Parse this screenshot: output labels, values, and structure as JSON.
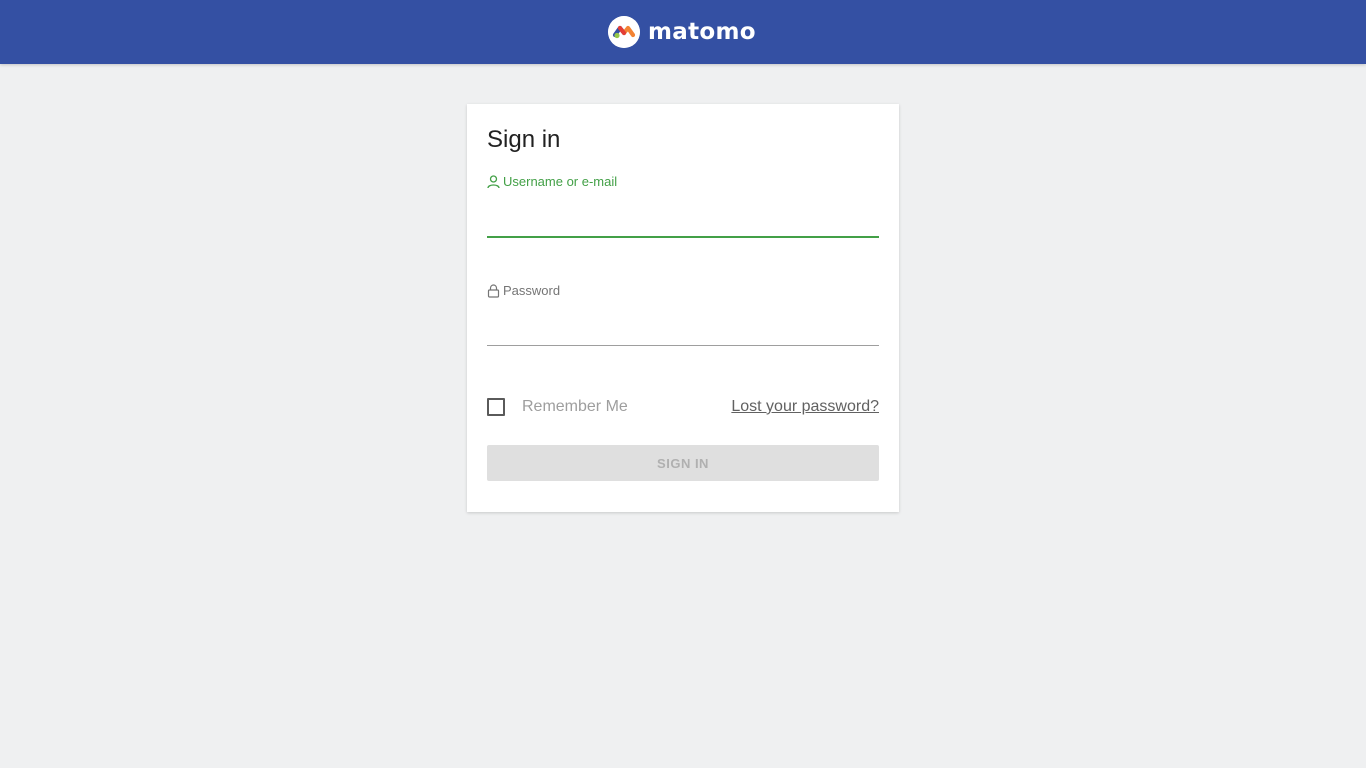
{
  "brand": {
    "name": "matomo",
    "header_color": "#3450a3"
  },
  "login": {
    "title": "Sign in",
    "username": {
      "label": "Username or e-mail",
      "icon": "user-icon",
      "value": "",
      "placeholder": "",
      "accent": "#43a047"
    },
    "password": {
      "label": "Password",
      "icon": "lock-icon",
      "value": "",
      "placeholder": ""
    },
    "remember_label": "Remember Me",
    "remember_checked": false,
    "lost_password_label": "Lost your password?",
    "submit_label": "SIGN IN"
  }
}
